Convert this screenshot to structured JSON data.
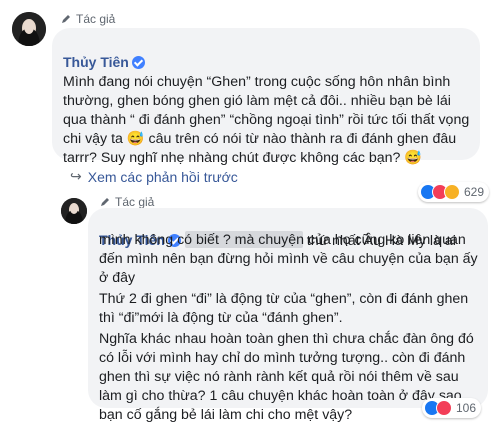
{
  "comment1": {
    "badge": "Tác giả",
    "author": "Thủy Tiên",
    "text": "Mình đang nói chuyện “Ghen” trong cuộc sống hôn nhân bình thường, ghen bóng ghen gió làm mệt cả đôi.. nhiều bạn bè lái qua thành “ đi đánh ghen” “chồng ngoại tình” rồi tức tối thất vọng chi vậy ta 😅 câu trên có nói từ nào thành ra đi đánh ghen đâu tarrr? Suy nghĩ nhẹ nhàng chút được không các bạn? 😅",
    "reaction_count": "629",
    "reaction_icons": [
      "like-icon",
      "love-icon",
      "haha-icon"
    ]
  },
  "replies_link": "Xem các phản hồi trước",
  "comment2": {
    "badge": "Tác giả",
    "author": "Thủy Tiên",
    "line1_after_redaction": "thứ nhất Âu Hà My là ai",
    "para1": "mình không có biết ? mà chuyện của họ cũng ko liên quan đến mình nên bạn đừng hỏi mình về câu chuyện của bạn ấy ở đây",
    "para2": "Thứ 2 đi ghen “đi” là động từ của “ghen”, còn đi đánh ghen thì “đi”mới là động từ của “đánh ghen”.",
    "para3": "Nghĩa khác nhau hoàn toàn ghen thì chưa chắc đàn ông đó có lỗi với mình hay chỉ do mình tưởng tượng.. còn đi đánh ghen thì sự việc nó rành rành kết quả rồi nói thêm về sau làm gì cho thừa? 1 câu chuyện khác hoàn toàn ở đây sao bạn cố gắng bẻ lái làm chi cho mệt vậy?",
    "reaction_count": "106",
    "reaction_icons": [
      "like-icon",
      "love-icon"
    ]
  }
}
